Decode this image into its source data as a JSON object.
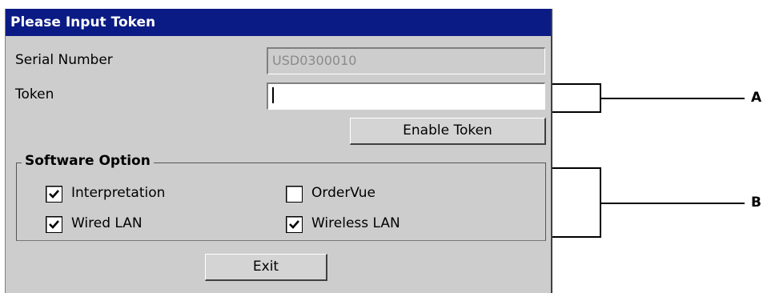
{
  "dialog": {
    "title": "Please Input Token",
    "serial": {
      "label": "Serial Number",
      "value": "USD0300010"
    },
    "token": {
      "label": "Token",
      "value": ""
    },
    "enable_button": "Enable Token",
    "software_option": {
      "title": "Software Option",
      "options": [
        {
          "label": "Interpretation",
          "checked": true
        },
        {
          "label": "OrderVue",
          "checked": false
        },
        {
          "label": "Wired LAN",
          "checked": true
        },
        {
          "label": "Wireless LAN",
          "checked": true
        }
      ]
    },
    "exit_button": "Exit"
  },
  "callouts": {
    "a": "A",
    "b": "B"
  },
  "colors": {
    "titlebar": "#0b1b85",
    "dialog_bg": "#cdcdcd"
  }
}
